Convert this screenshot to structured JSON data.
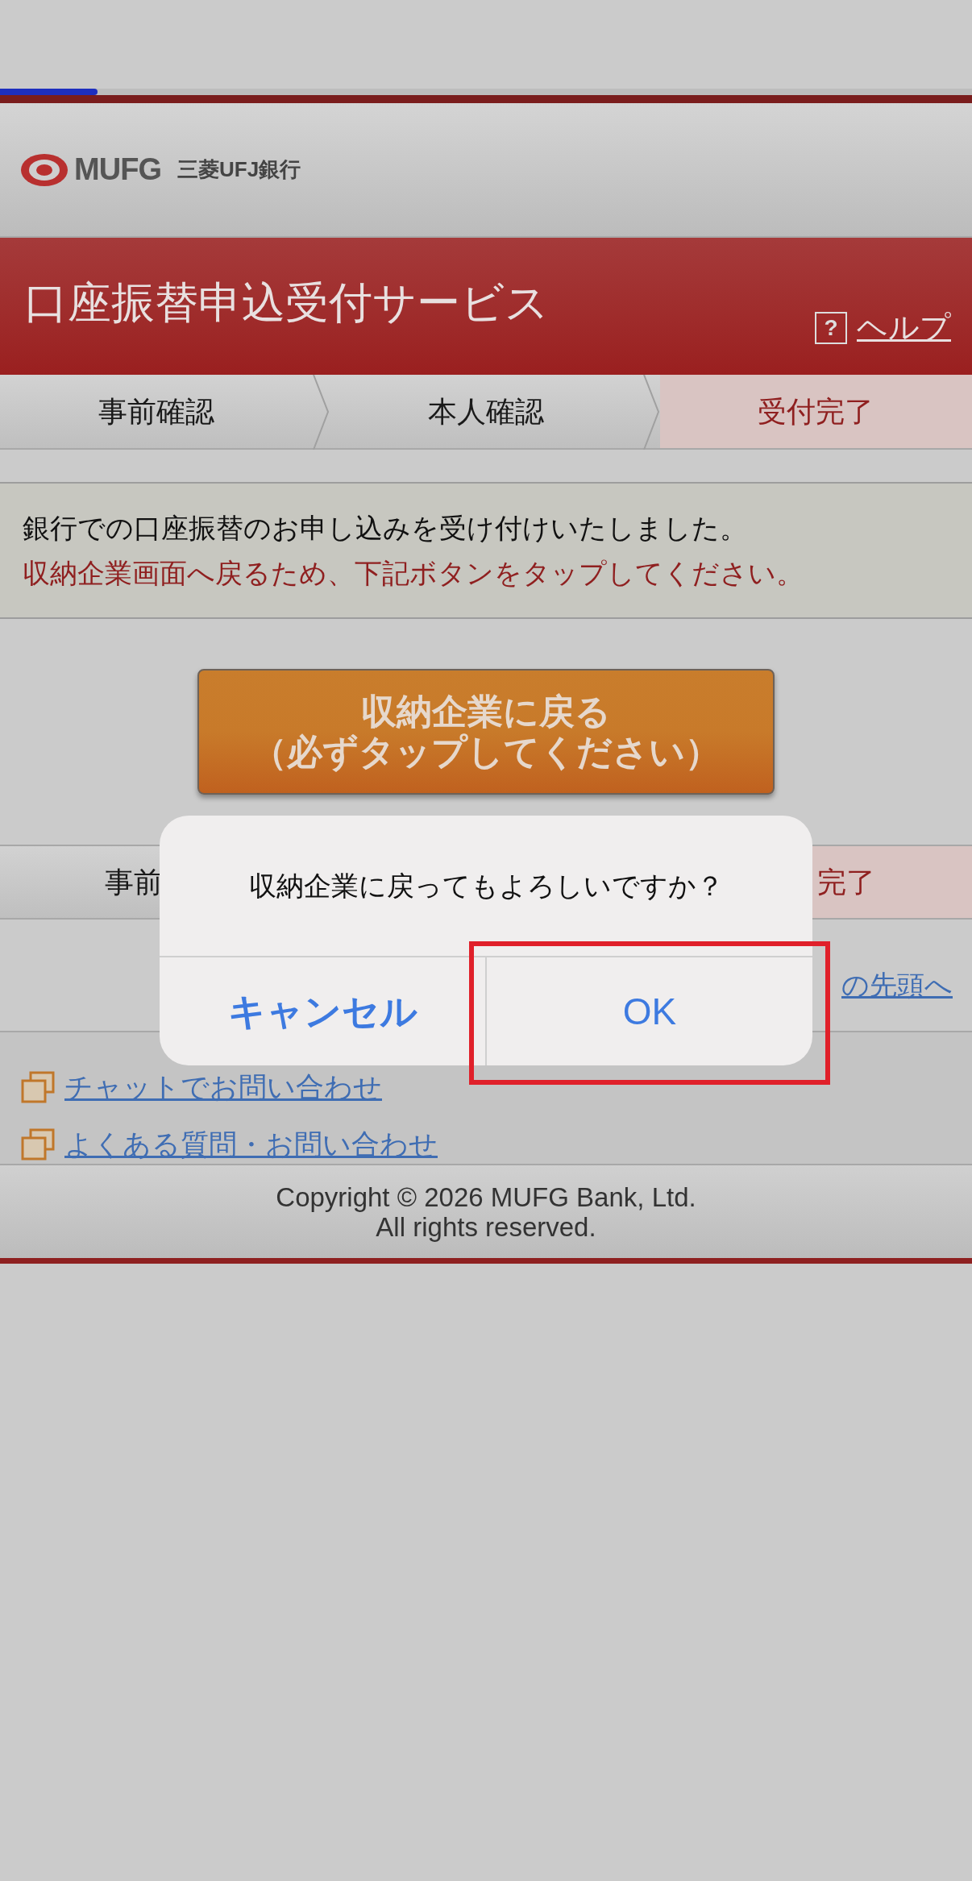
{
  "progress": {
    "level": 0.1
  },
  "header": {
    "logo_text": "MUFG",
    "bank_name": "三菱UFJ銀行"
  },
  "title_bar": {
    "title": "口座振替申込受付サービス",
    "help_icon": "?",
    "help_label": "ヘルプ"
  },
  "steps": [
    {
      "label": "事前確認",
      "selected": false
    },
    {
      "label": "本人確認",
      "selected": false
    },
    {
      "label": "受付完了",
      "selected": true
    }
  ],
  "message": [
    {
      "text": "銀行での口座振替のお申し込みを受け付けいたしました。",
      "kind": "normal"
    },
    {
      "text": "収納企業画面へ戻るため、下記ボタンをタップしてください。",
      "kind": "alert"
    }
  ],
  "return_button": {
    "lines": [
      "収納企業に戻る",
      "（必ずタップしてください）"
    ]
  },
  "steps_bottom": [
    {
      "label": "事前",
      "selected": false
    },
    {
      "label": "完了",
      "selected": true
    }
  ],
  "page_top_link": "の先頭へ",
  "links": [
    "チャットでお問い合わせ",
    "よくある質問・お問い合わせ"
  ],
  "footer": [
    "Copyright © 2026 MUFG Bank, Ltd.",
    "All rights reserved."
  ],
  "dialog": {
    "message": "収納企業に戻ってもよろしいですか？",
    "buttons": [
      {
        "label": "キャンセル",
        "kind": "cancel",
        "highlighted": false
      },
      {
        "label": "OK",
        "kind": "default",
        "highlighted": true
      }
    ]
  }
}
